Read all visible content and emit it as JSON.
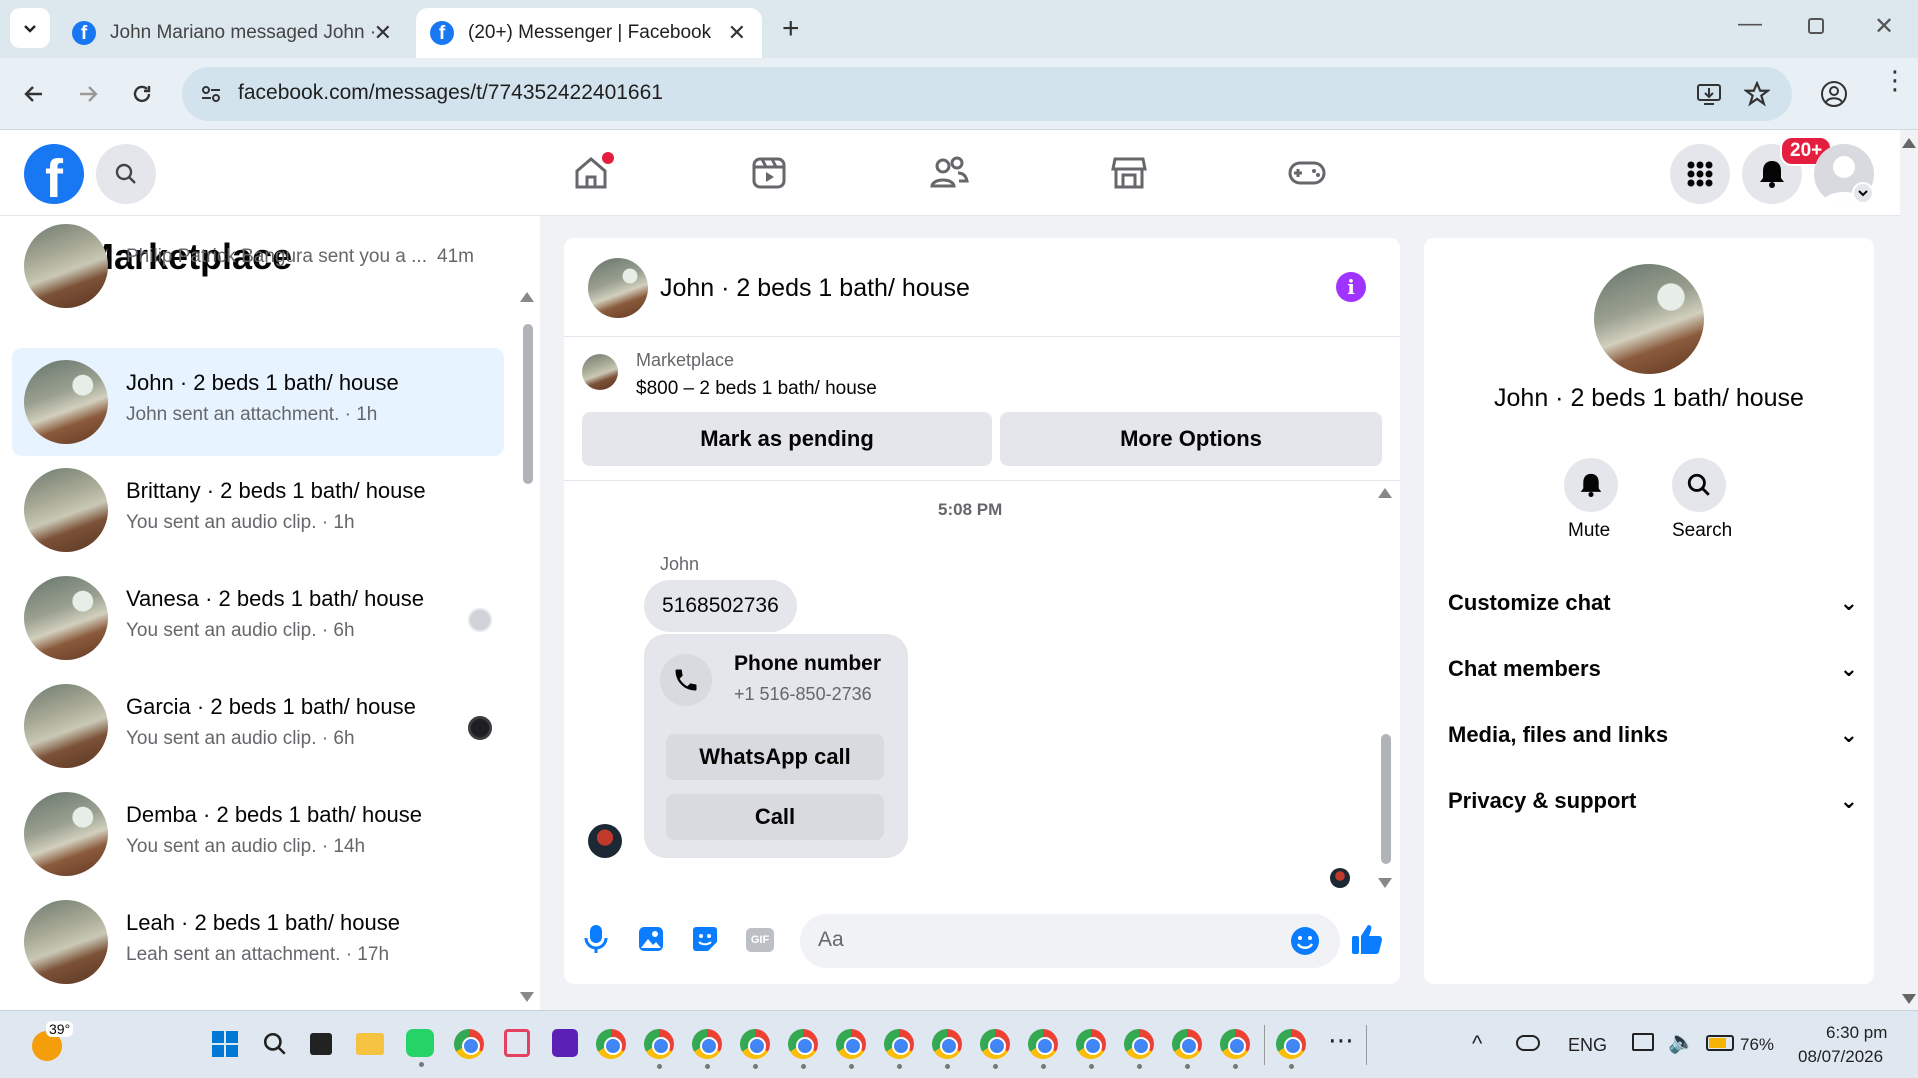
{
  "browser": {
    "tabs": [
      {
        "title": "John Mariano messaged John ·",
        "active": false
      },
      {
        "title": "(20+) Messenger | Facebook",
        "active": true
      }
    ],
    "url": "facebook.com/messages/t/774352422401661"
  },
  "header": {
    "notification_badge": "20+"
  },
  "left": {
    "title": "Marketplace",
    "conversations": [
      {
        "name": "",
        "sub": "Philip Patrick Bangura sent you a ...",
        "time": "41m"
      },
      {
        "name": "John · 2 beds 1 bath/ house",
        "sub": "John sent an attachment. · 1h",
        "active": true
      },
      {
        "name": "Brittany · 2 beds 1 bath/ house",
        "sub": "You sent an audio clip. · 1h"
      },
      {
        "name": "Vanesa · 2 beds 1 bath/ house",
        "sub": "You sent an audio clip. · 6h"
      },
      {
        "name": "Garcia · 2 beds 1 bath/ house",
        "sub": "You sent an audio clip. · 6h"
      },
      {
        "name": "Demba · 2 beds 1 bath/ house",
        "sub": "You sent an audio clip. · 14h"
      },
      {
        "name": "Leah · 2 beds 1 bath/ house",
        "sub": "Leah sent an attachment. · 17h"
      }
    ]
  },
  "chat": {
    "title": "John · 2 beds 1 bath/ house",
    "listing": {
      "source": "Marketplace",
      "price_title": "$800 – 2 beds 1 bath/ house"
    },
    "buttons": {
      "pending": "Mark as pending",
      "more": "More Options"
    },
    "timestamp": "5:08 PM",
    "sender": "John",
    "message": "5168502736",
    "phone_card": {
      "title": "Phone number",
      "number": "+1 516-850-2736",
      "whatsapp": "WhatsApp call",
      "call": "Call"
    },
    "input_placeholder": "Aa"
  },
  "right": {
    "name": "John · 2 beds 1 bath/ house",
    "actions": {
      "mute": "Mute",
      "search": "Search"
    },
    "menu": [
      "Customize chat",
      "Chat members",
      "Media, files and links",
      "Privacy & support"
    ]
  },
  "taskbar": {
    "weather": "39°",
    "lang": "ENG",
    "battery": "76%",
    "time": "6:30 pm",
    "date": "08/07/2026"
  },
  "colors": {
    "fb_blue": "#1877f2",
    "info_purple": "#a033ff",
    "badge_red": "#e41e3f"
  }
}
